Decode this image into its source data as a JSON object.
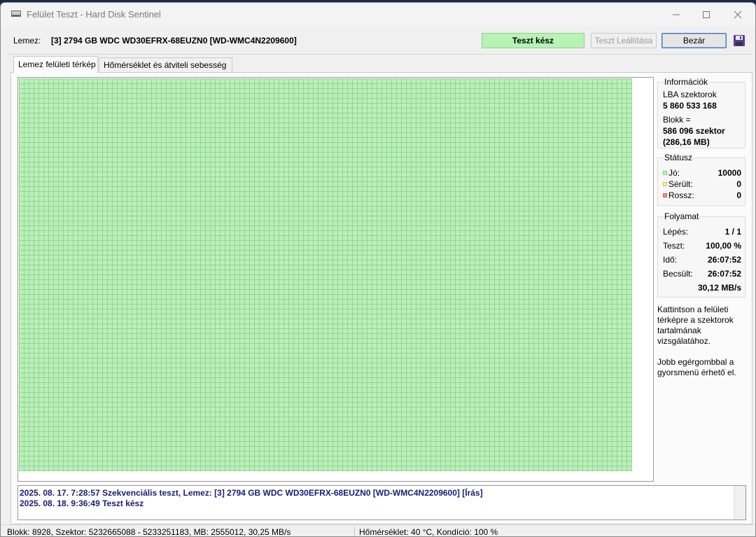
{
  "window": {
    "title": "Felület Teszt - Hard Disk Sentinel"
  },
  "toolbar": {
    "disk_label": "Lemez:",
    "disk_value": "[3] 2794 GB  WDC WD30EFRX-68EUZN0 [WD-WMC4N2209600]",
    "status": "Teszt kész",
    "stop_button": "Teszt Leállítása",
    "close_button": "Bezár"
  },
  "tabs": [
    {
      "label": "Lemez felületi térkép",
      "active": true
    },
    {
      "label": "Hőmérséklet és átviteli sebesség",
      "active": false
    }
  ],
  "info": {
    "title": "Információk",
    "lba_label": "LBA szektorok",
    "lba_value": "5 860 533 168",
    "block_label": "Blokk =",
    "block_sectors": "586 096 szektor",
    "block_size": "(286,16 MB)"
  },
  "status": {
    "title": "Státusz",
    "good_label": "Jó:",
    "good_value": "10000",
    "damaged_label": "Sérült:",
    "damaged_value": "0",
    "bad_label": "Rossz:",
    "bad_value": "0",
    "colors": {
      "good": "#b8f1b7",
      "damaged": "#f0f090",
      "bad": "#f09090"
    }
  },
  "progress": {
    "title": "Folyamat",
    "step_label": "Lépés:",
    "step_value": "1 / 1",
    "test_label": "Teszt:",
    "test_value": "100,00 %",
    "time_label": "Idő:",
    "time_value": "26:07:52",
    "estimate_label": "Becsült:",
    "estimate_value": "26:07:52",
    "speed": "30,12 MB/s"
  },
  "help": {
    "line1a": "Kattintson a felületi",
    "line1b": "térképre a szektorok",
    "line1c": "tartalmának",
    "line1d": "vizsgálatához.",
    "line2a": "Jobb egérgombbal a",
    "line2b": "gyorsmenü érhető el."
  },
  "log": [
    "2025. 08. 17.  7:28:57  Szekvenciális teszt, Lemez: [3] 2794 GB  WDC WD30EFRX-68EUZN0 [WD-WMC4N2209600] [Írás]",
    "2025. 08. 18.  9:36:49  Teszt kész"
  ],
  "statusbar": {
    "left": "Blokk: 8928, Szektor: 5232665088 - 5233251183, MB: 2555012, 30,25 MB/s",
    "right": "Hőmérséklet: 40  °C,  Kondíció: 100 %"
  }
}
